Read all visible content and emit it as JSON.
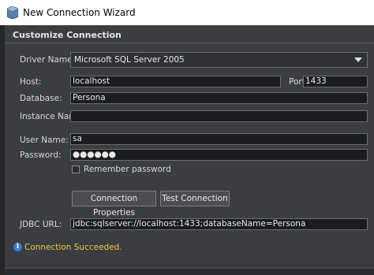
{
  "window": {
    "title": "New Connection Wizard",
    "icon": "app-icon"
  },
  "section": {
    "title": "Customize Connection"
  },
  "form": {
    "driver_label": "Driver Name:",
    "driver_value": "Microsoft SQL Server 2005",
    "host_label": "Host:",
    "host_value": "localhost",
    "port_label": "Port:",
    "port_value": "1433",
    "database_label": "Database:",
    "database_value": "Persona",
    "instance_label": "Instance Name:",
    "instance_value": "",
    "user_label": "User Name:",
    "user_value": "sa",
    "password_label": "Password:",
    "password_value": "●●●●●●",
    "remember_label": "Remember password",
    "remember_checked": false,
    "jdbc_label": "JDBC URL:",
    "jdbc_value": "jdbc:sqlserver://localhost:1433;databaseName=Persona"
  },
  "buttons": {
    "connection_properties": "Connection Properties",
    "test_connection": "Test Connection"
  },
  "status": {
    "icon": "info-icon",
    "message": "Connection Succeeded."
  },
  "colors": {
    "dialog_bg": "#3b3d40",
    "status_text": "#e8c84a",
    "info_icon": "#3d7bd4"
  }
}
